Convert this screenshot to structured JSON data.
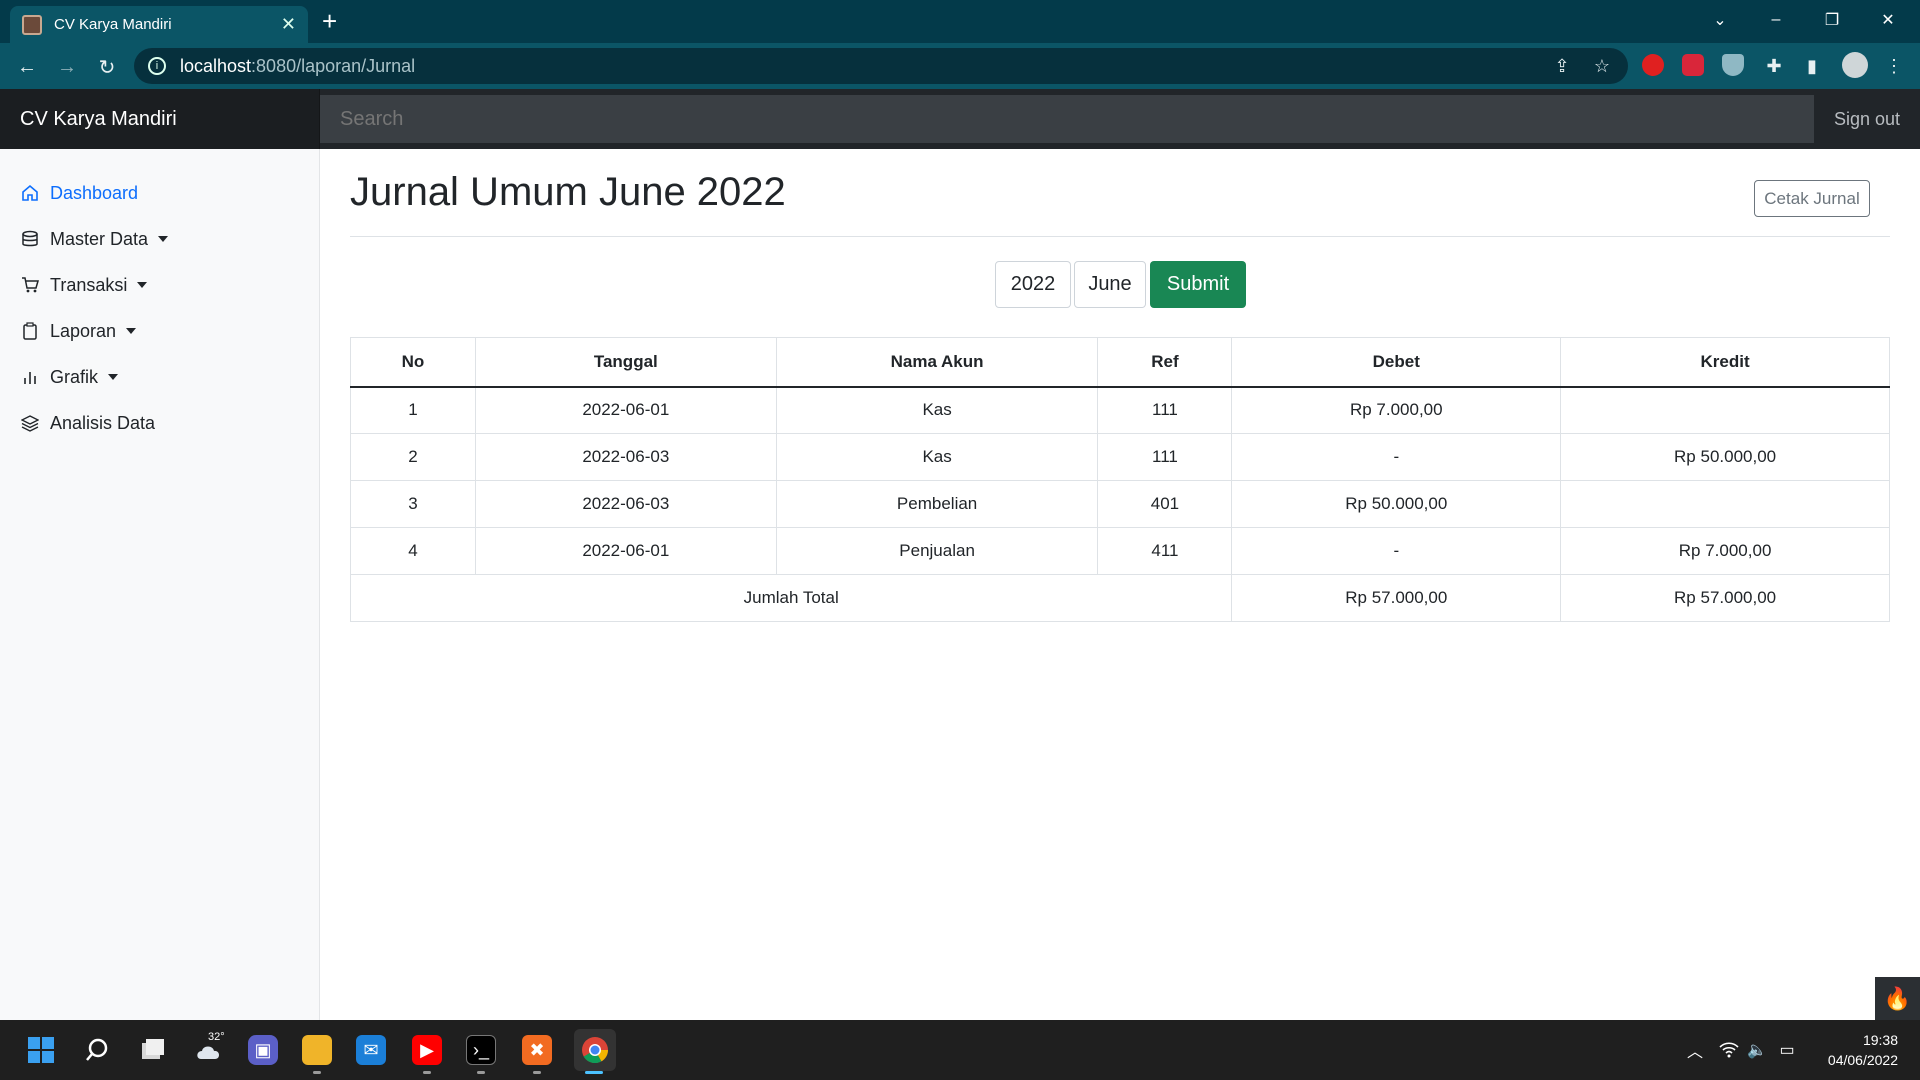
{
  "browser": {
    "tab_title": "CV Karya Mandiri",
    "url_host": "localhost",
    "url_path": ":8080/laporan/Jurnal"
  },
  "navbar": {
    "brand": "CV Karya Mandiri",
    "search_placeholder": "Search",
    "signout": "Sign out"
  },
  "sidebar": {
    "items": [
      {
        "label": "Dashboard",
        "icon": "home-icon",
        "active": true
      },
      {
        "label": "Master Data",
        "icon": "database-icon",
        "dropdown": true
      },
      {
        "label": "Transaksi",
        "icon": "cart-icon",
        "dropdown": true
      },
      {
        "label": "Laporan",
        "icon": "clipboard-icon",
        "dropdown": true
      },
      {
        "label": "Grafik",
        "icon": "bar-chart-icon",
        "dropdown": true
      },
      {
        "label": "Analisis Data",
        "icon": "layers-icon"
      }
    ]
  },
  "main": {
    "title": "Jurnal Umum June 2022",
    "print_button": "Cetak Jurnal",
    "filter": {
      "year": "2022",
      "month": "June",
      "submit": "Submit"
    },
    "table": {
      "headers": [
        "No",
        "Tanggal",
        "Nama Akun",
        "Ref",
        "Debet",
        "Kredit"
      ],
      "rows": [
        [
          "1",
          "2022-06-01",
          "Kas",
          "111",
          "Rp 7.000,00",
          ""
        ],
        [
          "2",
          "2022-06-03",
          "Kas",
          "111",
          "-",
          "Rp 50.000,00"
        ],
        [
          "3",
          "2022-06-03",
          "Pembelian",
          "401",
          "Rp 50.000,00",
          ""
        ],
        [
          "4",
          "2022-06-01",
          "Penjualan",
          "411",
          "-",
          "Rp 7.000,00"
        ]
      ],
      "total_label": "Jumlah Total",
      "total_debet": "Rp 57.000,00",
      "total_kredit": "Rp 57.000,00"
    }
  },
  "taskbar": {
    "weather": "32°",
    "time": "19:38",
    "date": "04/06/2022"
  },
  "colors": {
    "accent": "#0d6efd",
    "submit": "#198754",
    "chrome": "#0b5566"
  }
}
